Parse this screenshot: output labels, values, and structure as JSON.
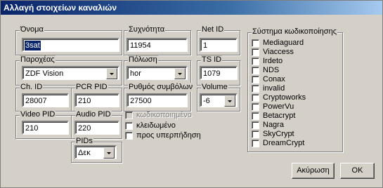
{
  "window": {
    "title": "Αλλαγή στοιχείων καναλιών"
  },
  "name": {
    "label": "Όνομα",
    "value": "3sat"
  },
  "frequency": {
    "label": "Συχνότητα",
    "value": "11954"
  },
  "net_id": {
    "label": "Net ID",
    "value": "1"
  },
  "provider": {
    "label": "Παροχέας",
    "value": "ZDF Vision"
  },
  "polarization": {
    "label": "Πόλωση",
    "value": "hor"
  },
  "ts_id": {
    "label": "TS ID",
    "value": "1079"
  },
  "ch_id": {
    "label": "Ch. ID",
    "value": "28007"
  },
  "pcr_pid": {
    "label": "PCR PID",
    "value": "210"
  },
  "symbol_rate": {
    "label": "Ρυθμός συμβόλων",
    "value": "27500"
  },
  "volume": {
    "label": "Volume",
    "value": "-6"
  },
  "video_pid": {
    "label": "Video PID",
    "value": "210"
  },
  "audio_pid": {
    "label": "Audio PID",
    "value": "220"
  },
  "pids": {
    "label": "PIDs",
    "value": "Δεκ"
  },
  "options": {
    "encrypted": "κωδικοποιημένο",
    "locked": "κλειδωμένο",
    "favorite": "προς υπερπήδηση"
  },
  "encryption": {
    "label": "Σύστημα κωδικοποίησης",
    "items": [
      "Mediaguard",
      "Viaccess",
      "Irdeto",
      "NDS",
      "Conax",
      "invalid",
      "Cryptoworks",
      "PowerVu",
      "Betacrypt",
      "Nagra",
      "SkyCrypt",
      "DreamCrypt"
    ]
  },
  "buttons": {
    "cancel": "Ακύρωση",
    "ok": "OK"
  }
}
